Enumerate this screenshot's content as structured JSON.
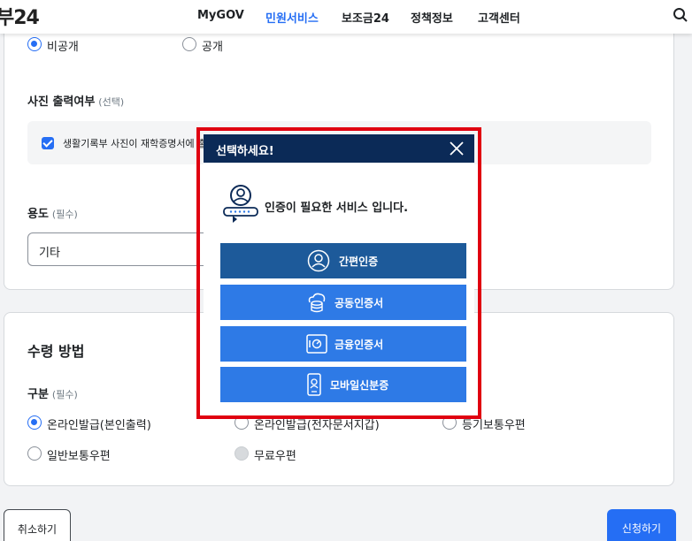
{
  "header": {
    "logo": "부24",
    "nav": [
      "MyGOV",
      "민원서비스",
      "보조금24",
      "정책정보",
      "고객센터"
    ],
    "active_nav": "민원서비스"
  },
  "disclosure": {
    "private_label": "비공개",
    "public_label": "공개",
    "selected": "비공개"
  },
  "photo": {
    "title": "사진 출력여부",
    "hint": "(선택)",
    "checkbox_label": "생활기록부 사진이 재학증명서에 출",
    "checked": true
  },
  "usage": {
    "title": "용도",
    "hint": "(필수)",
    "value": "기타"
  },
  "receipt": {
    "title": "수령 방법",
    "category_title": "구분",
    "category_hint": "(필수)",
    "options": [
      "온라인발급(본인출력)",
      "온라인발급(전자문서지갑)",
      "등기보통우편",
      "일반보통우편",
      "무료우편"
    ],
    "selected": "온라인발급(본인출력)"
  },
  "buttons": {
    "cancel": "취소하기",
    "apply": "신청하기"
  },
  "modal": {
    "title": "선택하세요!",
    "message": "인증이 필요한 서비스 입니다.",
    "options": [
      "간편인증",
      "공동인증서",
      "금융인증서",
      "모바일신분증"
    ]
  },
  "colors": {
    "primary": "#256ef4",
    "modal_header": "#0b2a57",
    "simple_auth": "#1d5a9a",
    "auth_button": "#2e7ae6",
    "highlight": "#e00010"
  }
}
